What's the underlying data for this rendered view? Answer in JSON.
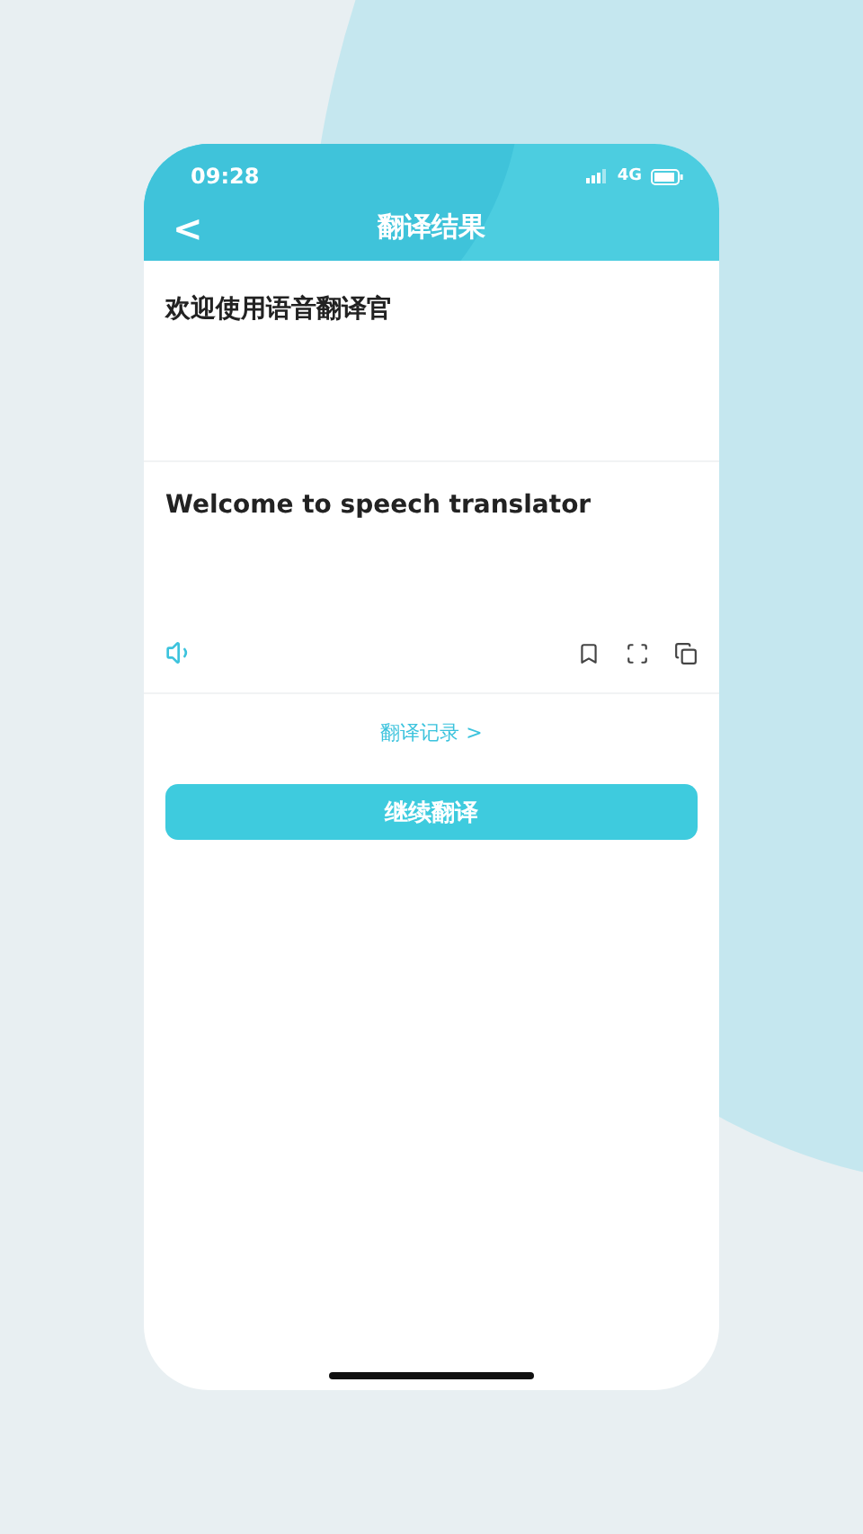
{
  "status_bar": {
    "time": "09:28",
    "network": "4G"
  },
  "header": {
    "back": "<",
    "title": "翻译结果"
  },
  "source_text": "欢迎使用语音翻译官",
  "translated_text": "Welcome to speech translator",
  "history_link": "翻译记录 >",
  "continue_button": "继续翻译"
}
